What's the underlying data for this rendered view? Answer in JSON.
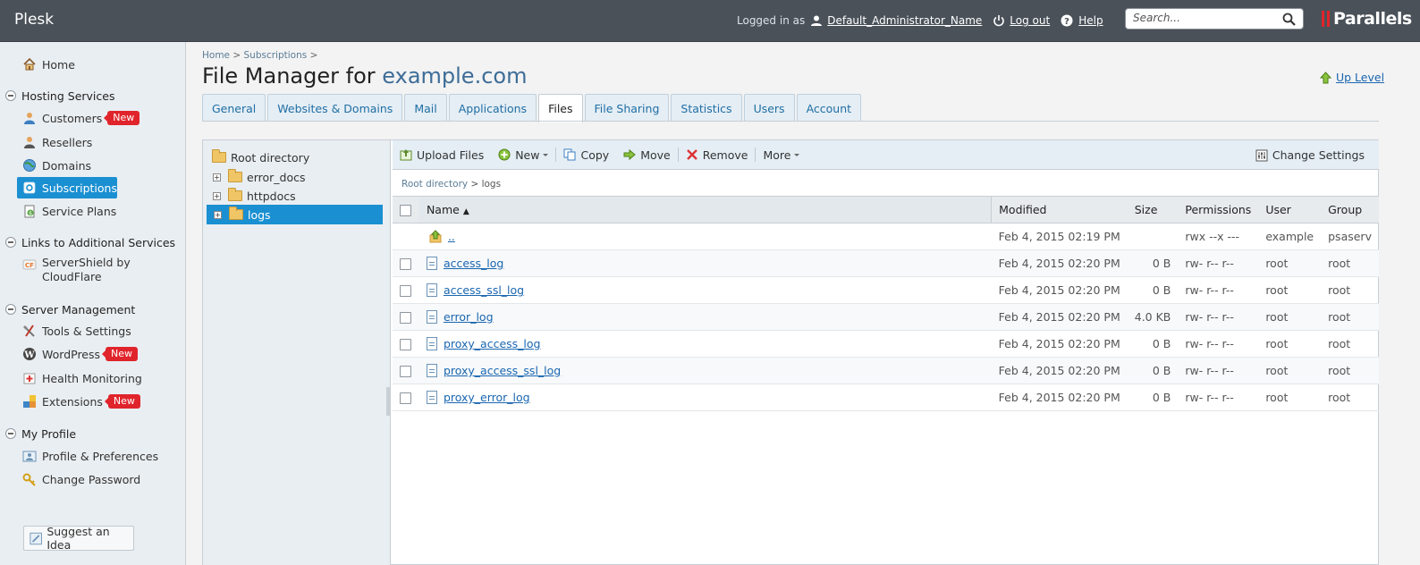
{
  "topbar": {
    "logo": "Plesk",
    "logged_in_as": "Logged in as",
    "user": "Default_Administrator_Name",
    "logout": "Log out",
    "help": "Help",
    "search_placeholder": "Search...",
    "brand": "Parallels"
  },
  "sidebar": {
    "home": "Home",
    "hosting_services": "Hosting Services",
    "customers": "Customers",
    "resellers": "Resellers",
    "domains": "Domains",
    "subscriptions": "Subscriptions",
    "service_plans": "Service Plans",
    "links_additional": "Links to Additional Services",
    "servershield": "ServerShield by CloudFlare",
    "server_management": "Server Management",
    "tools_settings": "Tools & Settings",
    "wordpress": "WordPress",
    "health_monitoring": "Health Monitoring",
    "extensions": "Extensions",
    "my_profile": "My Profile",
    "profile_prefs": "Profile & Preferences",
    "change_password": "Change Password",
    "new_badge": "New",
    "suggest": "Suggest an Idea"
  },
  "breadcrumb": {
    "home": "Home",
    "subscriptions": "Subscriptions",
    "sep": ">"
  },
  "page": {
    "title_prefix": "File Manager for",
    "title_domain": "example.com",
    "up_level": "Up Level"
  },
  "tabs": [
    "General",
    "Websites & Domains",
    "Mail",
    "Applications",
    "Files",
    "File Sharing",
    "Statistics",
    "Users",
    "Account"
  ],
  "tree": {
    "root": "Root directory",
    "items": [
      "error_docs",
      "httpdocs",
      "logs"
    ]
  },
  "toolbar": {
    "upload": "Upload Files",
    "new": "New",
    "copy": "Copy",
    "move": "Move",
    "remove": "Remove",
    "more": "More",
    "change_settings": "Change Settings"
  },
  "path": {
    "root": "Root directory",
    "current": "logs"
  },
  "table": {
    "headers": {
      "name": "Name",
      "modified": "Modified",
      "size": "Size",
      "permissions": "Permissions",
      "user": "User",
      "group": "Group"
    },
    "up": {
      "name": "..",
      "modified": "Feb 4, 2015 02:19 PM",
      "size": "",
      "permissions": "rwx --x ---",
      "user": "example",
      "group": "psaserv"
    },
    "rows": [
      {
        "name": "access_log",
        "modified": "Feb 4, 2015 02:20 PM",
        "size": "0 B",
        "permissions": "rw- r-- r--",
        "user": "root",
        "group": "root"
      },
      {
        "name": "access_ssl_log",
        "modified": "Feb 4, 2015 02:20 PM",
        "size": "0 B",
        "permissions": "rw- r-- r--",
        "user": "root",
        "group": "root"
      },
      {
        "name": "error_log",
        "modified": "Feb 4, 2015 02:20 PM",
        "size": "4.0 KB",
        "permissions": "rw- r-- r--",
        "user": "root",
        "group": "root"
      },
      {
        "name": "proxy_access_log",
        "modified": "Feb 4, 2015 02:20 PM",
        "size": "0 B",
        "permissions": "rw- r-- r--",
        "user": "root",
        "group": "root"
      },
      {
        "name": "proxy_access_ssl_log",
        "modified": "Feb 4, 2015 02:20 PM",
        "size": "0 B",
        "permissions": "rw- r-- r--",
        "user": "root",
        "group": "root"
      },
      {
        "name": "proxy_error_log",
        "modified": "Feb 4, 2015 02:20 PM",
        "size": "0 B",
        "permissions": "rw- r-- r--",
        "user": "root",
        "group": "root"
      }
    ]
  }
}
